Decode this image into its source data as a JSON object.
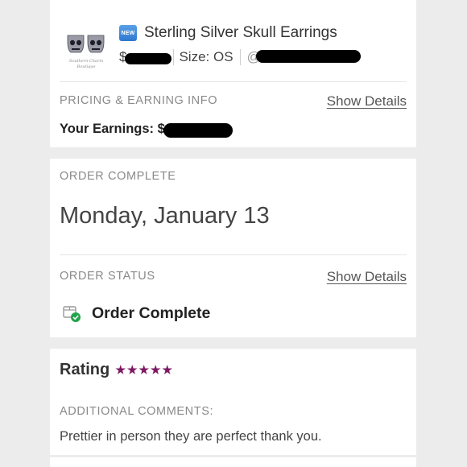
{
  "item": {
    "badge": "NEW",
    "title": "Sterling Silver Skull Earrings",
    "price_prefix": "$",
    "size_label": "Size: OS",
    "seller_prefix": "@",
    "thumb_caption_1": "Southern Charm",
    "thumb_caption_2": "Boutique"
  },
  "pricing": {
    "section_label": "PRICING & EARNING INFO",
    "show_details": "Show Details",
    "earnings_label": "Your Earnings: $"
  },
  "order": {
    "complete_label": "ORDER COMPLETE",
    "date": "Monday, January 13",
    "status_label": "ORDER STATUS",
    "show_details": "Show Details",
    "status_text": "Order Complete"
  },
  "rating": {
    "label": "Rating",
    "stars": 5,
    "comments_label": "ADDITIONAL COMMENTS:",
    "comment": "Prettier in person they are perfect thank you."
  },
  "colors": {
    "background": "#ececec",
    "star": "#7d1863",
    "check": "#21a34a"
  }
}
